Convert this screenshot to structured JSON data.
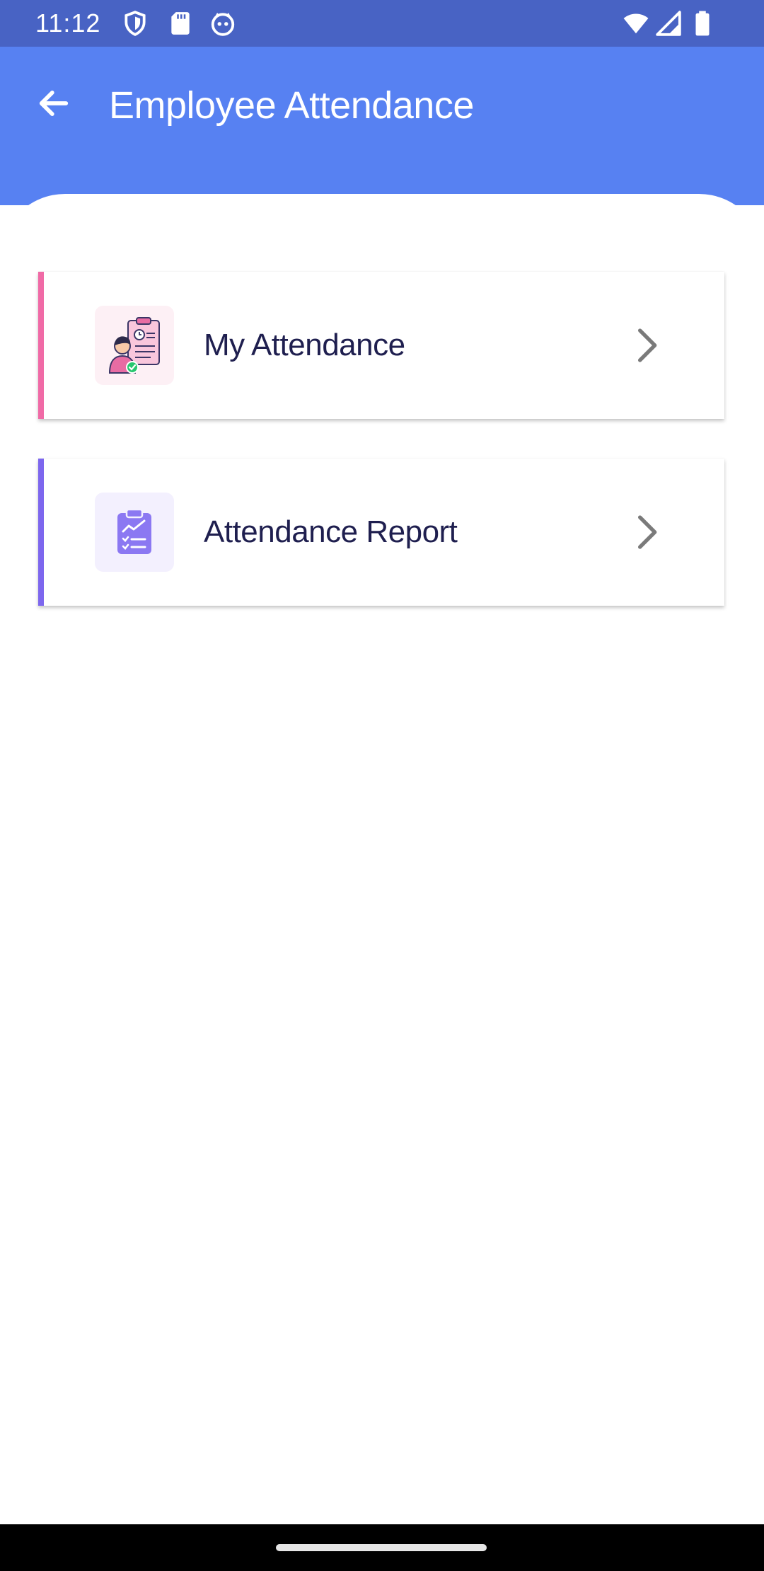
{
  "status_bar": {
    "time": "11:12",
    "left_icons": [
      "shield-icon",
      "sd-card-icon",
      "cat-face-icon"
    ],
    "right_icons": [
      "wifi-icon",
      "cell-signal-icon",
      "battery-icon"
    ],
    "background": "#4863c4"
  },
  "app_bar": {
    "title": "Employee Attendance",
    "back_icon": "arrow-back-icon",
    "background": "#5781f2"
  },
  "menu": {
    "items": [
      {
        "label": "My Attendance",
        "icon": "attendance-person-icon",
        "accent": "#f06aa6",
        "chevron": "chevron-right-icon"
      },
      {
        "label": "Attendance Report",
        "icon": "clipboard-report-icon",
        "accent": "#7d67ee",
        "chevron": "chevron-right-icon"
      }
    ]
  }
}
